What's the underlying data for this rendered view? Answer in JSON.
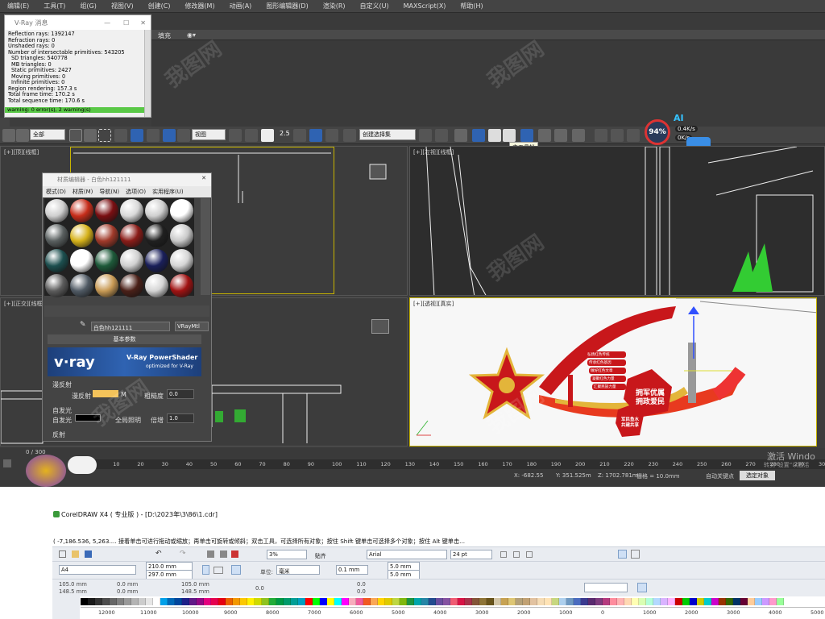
{
  "menu": [
    "编辑(E)",
    "工具(T)",
    "组(G)",
    "视图(V)",
    "创建(C)",
    "修改器(M)",
    "动画(A)",
    "图形编辑器(D)",
    "渲染(R)",
    "自定义(U)",
    "MAXScript(X)",
    "帮助(H)"
  ],
  "vray": {
    "title": "V-Ray 消息",
    "lines": [
      "Reflection rays: 1392147",
      "Refraction rays: 0",
      "Unshaded rays: 0",
      "Number of intersectable primitives: 543205",
      "SD triangles: 540778",
      "MB triangles: 0",
      "Static primitives: 2427",
      "Moving primitives: 0",
      "Infinite primitives: 0",
      "Region rendering: 157.3 s",
      "Total frame time: 170.2 s",
      "Total sequence time: 170.6 s"
    ],
    "warning": "warning: 0 error(s), 2 warning(s)"
  },
  "fill_label": "填充",
  "toolbar": {
    "all": "全部",
    "view": "视图",
    "selset": "创建选择集",
    "snap": "2.5",
    "tooltip": "主工具栏",
    "percent": "94%",
    "rate_up": "0.4K/s",
    "rate_down": "0K/s",
    "ai": "AI"
  },
  "viewports": {
    "tl": "[+][顶][线框]",
    "tr": "[+][左视][线框]",
    "bl": "[+][正交][线框]",
    "br": "[+][透视][真实]"
  },
  "mat": {
    "title": "材质编辑器 - 白色hh121111",
    "menu": [
      "模式(D)",
      "材质(M)",
      "导航(N)",
      "选项(O)",
      "实用程序(U)"
    ],
    "name": "白色hh121111",
    "type": "VRayMtl",
    "section": "基本参数",
    "brand": "v·ray",
    "product": "V-Ray PowerShader",
    "sub": "optimized for V-Ray",
    "diffuse_group": "漫反射",
    "diffuse": "漫反射",
    "roughness": "粗糙度",
    "rough_val": "0.0",
    "selfillum_group": "自发光",
    "selfillum": "自发光",
    "gi": "全局照明",
    "mult": "倍增",
    "mult_val": "1.0",
    "refl_group": "反射",
    "m": "M"
  },
  "board": {
    "list": [
      "弘扬红色传统",
      "传承红色基因",
      "做好红色文章",
      "凝聚红色力量",
      "汇聚民族力量"
    ],
    "slogan1": "拥军优属",
    "slogan2": "拥政爱民",
    "small1": "军民鱼水",
    "small2": "共建共享"
  },
  "timeline": {
    "frames": "0 / 300",
    "ticks": [
      "0",
      "10",
      "20",
      "30",
      "40",
      "50",
      "60",
      "70",
      "80",
      "90",
      "100",
      "110",
      "120",
      "130",
      "140",
      "150",
      "160",
      "170",
      "180",
      "190",
      "200",
      "210",
      "220",
      "230",
      "240",
      "250",
      "260",
      "270",
      "280",
      "290",
      "300"
    ]
  },
  "status": {
    "x": "X: -682.55",
    "y": "Y: 351.525m",
    "z": "Z: 1702.781m",
    "grid": "栅格 = 10.0mm",
    "autokey": "自动关键点",
    "selobj": "选定对象",
    "win1": "激活 Windo",
    "win2": "转到“设置”以激活"
  },
  "corel": {
    "title": "CorelDRAW X4 ( 专业版 ) - [D:\\2023年\\3\\86\\1.cdr]",
    "status": "( -7,186.536, 5,263.... 接着单击可进行拖动或缩放；再单击可旋转或倾斜；双击工具，可选择所有对象；按住 Shift 键单击可选择多个对象；按住 Alt 键单击...",
    "zoom": "3%",
    "snap": "贴齐",
    "font": "Arial",
    "size": "24 pt",
    "paper": "A4",
    "w": "210.0 mm",
    "h": "297.0 mm",
    "unit_label": "单位:",
    "unit": "毫米",
    "nudge": "0.1 mm",
    "dx": "5.0 mm",
    "dy": "5.0 mm",
    "x": "105.0 mm",
    "y": "148.5 mm",
    "sx": "0.0 mm",
    "sy": "0.0 mm",
    "sw": "105.0 mm",
    "sh": "148.5 mm",
    "angle": "0.0",
    "zero": "0.0",
    "ruler": [
      "12000",
      "11000",
      "10000",
      "9000",
      "8000",
      "7000",
      "6000",
      "5000",
      "4000",
      "3000",
      "2000",
      "1000",
      "0",
      "1000",
      "2000",
      "3000",
      "4000",
      "5000"
    ]
  },
  "watermark": "我图网",
  "colors": {
    "panel": "#3d3d3d",
    "accent": "#2f63b2",
    "warn": "#59c846",
    "red": "#c8171b",
    "gold": "#e3b53a"
  }
}
